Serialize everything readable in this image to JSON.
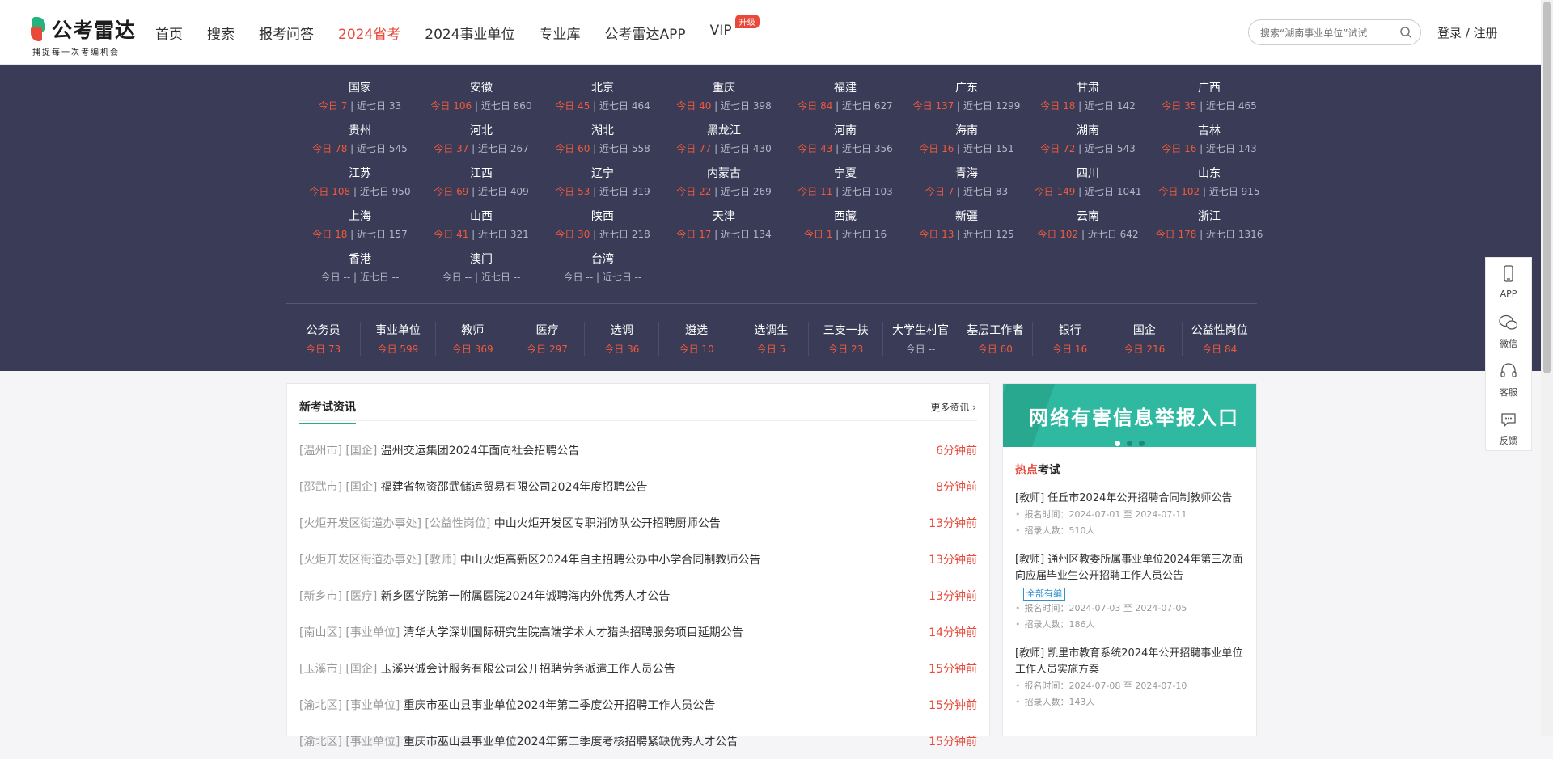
{
  "header": {
    "logo_text": "公考雷达",
    "logo_slogan": "捕捉每一次考编机会",
    "nav": [
      {
        "label": "首页",
        "active": false
      },
      {
        "label": "搜索",
        "active": false
      },
      {
        "label": "报考问答",
        "active": false
      },
      {
        "label": "2024省考",
        "active": true
      },
      {
        "label": "2024事业单位",
        "active": false
      },
      {
        "label": "专业库",
        "active": false
      },
      {
        "label": "公考雷达APP",
        "active": false
      },
      {
        "label": "VIP",
        "active": false
      }
    ],
    "vip_badge": "升级",
    "search_placeholder": "搜索“湖南事业单位”试试",
    "search_icon": "search-icon",
    "login": "登录",
    "separator": "/",
    "register": "注册"
  },
  "regions_labels": {
    "today": "今日",
    "week": "近七日"
  },
  "regions": [
    {
      "name": "国家",
      "today": "7",
      "week": "33"
    },
    {
      "name": "安徽",
      "today": "106",
      "week": "860"
    },
    {
      "name": "北京",
      "today": "45",
      "week": "464"
    },
    {
      "name": "重庆",
      "today": "40",
      "week": "398"
    },
    {
      "name": "福建",
      "today": "84",
      "week": "627"
    },
    {
      "name": "广东",
      "today": "137",
      "week": "1299"
    },
    {
      "name": "甘肃",
      "today": "18",
      "week": "142"
    },
    {
      "name": "广西",
      "today": "35",
      "week": "465"
    },
    {
      "name": "贵州",
      "today": "78",
      "week": "545"
    },
    {
      "name": "河北",
      "today": "37",
      "week": "267"
    },
    {
      "name": "湖北",
      "today": "60",
      "week": "558"
    },
    {
      "name": "黑龙江",
      "today": "77",
      "week": "430"
    },
    {
      "name": "河南",
      "today": "43",
      "week": "356"
    },
    {
      "name": "海南",
      "today": "16",
      "week": "151"
    },
    {
      "name": "湖南",
      "today": "72",
      "week": "543"
    },
    {
      "name": "吉林",
      "today": "16",
      "week": "143"
    },
    {
      "name": "江苏",
      "today": "108",
      "week": "950"
    },
    {
      "name": "江西",
      "today": "69",
      "week": "409"
    },
    {
      "name": "辽宁",
      "today": "53",
      "week": "319"
    },
    {
      "name": "内蒙古",
      "today": "22",
      "week": "269"
    },
    {
      "name": "宁夏",
      "today": "11",
      "week": "103"
    },
    {
      "name": "青海",
      "today": "7",
      "week": "83"
    },
    {
      "name": "四川",
      "today": "149",
      "week": "1041"
    },
    {
      "name": "山东",
      "today": "102",
      "week": "915"
    },
    {
      "name": "上海",
      "today": "18",
      "week": "157"
    },
    {
      "name": "山西",
      "today": "41",
      "week": "321"
    },
    {
      "name": "陕西",
      "today": "30",
      "week": "218"
    },
    {
      "name": "天津",
      "today": "17",
      "week": "134"
    },
    {
      "name": "西藏",
      "today": "1",
      "week": "16"
    },
    {
      "name": "新疆",
      "today": "13",
      "week": "125"
    },
    {
      "name": "云南",
      "today": "102",
      "week": "642"
    },
    {
      "name": "浙江",
      "today": "178",
      "week": "1316"
    },
    {
      "name": "香港",
      "today": "--",
      "week": "--"
    },
    {
      "name": "澳门",
      "today": "--",
      "week": "--"
    },
    {
      "name": "台湾",
      "today": "--",
      "week": "--"
    }
  ],
  "categories": [
    {
      "name": "公务员",
      "today": "今日 73"
    },
    {
      "name": "事业单位",
      "today": "今日 599"
    },
    {
      "name": "教师",
      "today": "今日 369"
    },
    {
      "name": "医疗",
      "today": "今日 297"
    },
    {
      "name": "选调",
      "today": "今日 36"
    },
    {
      "name": "遴选",
      "today": "今日 10"
    },
    {
      "name": "选调生",
      "today": "今日 5"
    },
    {
      "name": "三支一扶",
      "today": "今日 23"
    },
    {
      "name": "大学生村官",
      "today": "今日 --"
    },
    {
      "name": "基层工作者",
      "today": "今日 60"
    },
    {
      "name": "银行",
      "today": "今日 16"
    },
    {
      "name": "国企",
      "today": "今日 216"
    },
    {
      "name": "公益性岗位",
      "today": "今日 84"
    }
  ],
  "news": {
    "title": "新考试资讯",
    "more": "更多资讯 ›",
    "items": [
      {
        "tags": "[温州市] [国企]",
        "title": "温州交运集团2024年面向社会招聘公告",
        "time": "6分钟前"
      },
      {
        "tags": "[邵武市] [国企]",
        "title": "福建省物资邵武储运贸易有限公司2024年度招聘公告",
        "time": "8分钟前"
      },
      {
        "tags": "[火炬开发区街道办事处] [公益性岗位]",
        "title": "中山火炬开发区专职消防队公开招聘厨师公告",
        "time": "13分钟前"
      },
      {
        "tags": "[火炬开发区街道办事处] [教师]",
        "title": "中山火炬高新区2024年自主招聘公办中小学合同制教师公告",
        "time": "13分钟前"
      },
      {
        "tags": "[新乡市] [医疗]",
        "title": "新乡医学院第一附属医院2024年诚聘海内外优秀人才公告",
        "time": "13分钟前"
      },
      {
        "tags": "[南山区] [事业单位]",
        "title": "清华大学深圳国际研究生院高端学术人才猎头招聘服务项目延期公告",
        "time": "14分钟前"
      },
      {
        "tags": "[玉溪市] [国企]",
        "title": "玉溪兴诚会计服务有限公司公开招聘劳务派遣工作人员公告",
        "time": "15分钟前"
      },
      {
        "tags": "[渝北区] [事业单位]",
        "title": "重庆市巫山县事业单位2024年第二季度公开招聘工作人员公告",
        "time": "15分钟前"
      },
      {
        "tags": "[渝北区] [事业单位]",
        "title": "重庆市巫山县事业单位2024年第二季度考核招聘紧缺优秀人才公告",
        "time": "15分钟前"
      }
    ]
  },
  "banner": {
    "text": "网络有害信息举报入口"
  },
  "hot": {
    "title_hot": "热点",
    "title_rest": "考试",
    "items": [
      {
        "title": "[教师] 任丘市2024年公开招聘合同制教师公告",
        "chip": "",
        "signup": "报名时间：2024-07-01 至 2024-07-11",
        "count": "招录人数：510人"
      },
      {
        "title": "[教师] 通州区教委所属事业单位2024年第三次面向应届毕业生公开招聘工作人员公告",
        "chip": "全部有编",
        "signup": "报名时间：2024-07-03 至 2024-07-05",
        "count": "招录人数：186人"
      },
      {
        "title": "[教师] 凯里市教育系统2024年公开招聘事业单位工作人员实施方案",
        "chip": "",
        "signup": "报名时间：2024-07-08 至 2024-07-10",
        "count": "招录人数：143人"
      }
    ]
  },
  "float_bar": [
    {
      "label": "APP",
      "icon": "phone-icon"
    },
    {
      "label": "微信",
      "icon": "wechat-icon"
    },
    {
      "label": "客服",
      "icon": "headset-icon"
    },
    {
      "label": "反馈",
      "icon": "chat-bubble-icon"
    }
  ]
}
